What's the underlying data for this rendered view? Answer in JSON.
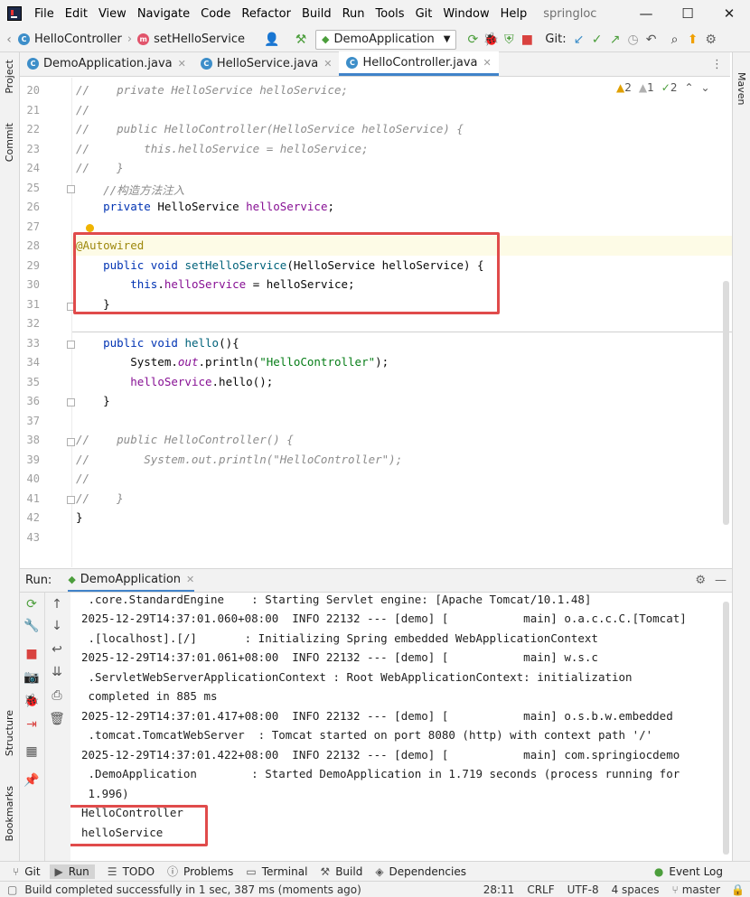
{
  "menubar": {
    "items": [
      "File",
      "Edit",
      "View",
      "Navigate",
      "Code",
      "Refactor",
      "Build",
      "Run",
      "Tools",
      "Git",
      "Window",
      "Help"
    ],
    "project": "springloc",
    "minimize": "—",
    "maximize": "☐",
    "close": "✕"
  },
  "navbar": {
    "breadcrumb_class": "HelloController",
    "breadcrumb_method": "setHelloService",
    "run_config": "DemoApplication",
    "git_label": "Git:"
  },
  "tabs": [
    {
      "label": "DemoApplication.java"
    },
    {
      "label": "HelloService.java"
    },
    {
      "label": "HelloController.java"
    }
  ],
  "side": {
    "project": "Project",
    "commit": "Commit",
    "structure": "Structure",
    "bookmarks": "Bookmarks",
    "maven": "Maven"
  },
  "inspections": {
    "warnings": "2",
    "weak": "1",
    "ok": "2"
  },
  "editor": {
    "line_numbers": [
      "20",
      "21",
      "22",
      "23",
      "24",
      "25",
      "26",
      "27",
      "28",
      "29",
      "30",
      "31",
      "32",
      "33",
      "34",
      "35",
      "36",
      "37",
      "38",
      "39",
      "40",
      "41",
      "42",
      "43"
    ]
  },
  "run_panel": {
    "label": "Run:",
    "tab": "DemoApplication",
    "console_lines": [
      " .core.StandardEngine    : Starting Servlet engine: [Apache Tomcat/10.1.48]",
      "2025-12-29T14:37:01.060+08:00  INFO 22132 --- [demo] [           main] o.a.c.c.C.[Tomcat]",
      " .[localhost].[/]       : Initializing Spring embedded WebApplicationContext",
      "2025-12-29T14:37:01.061+08:00  INFO 22132 --- [demo] [           main] w.s.c",
      " .ServletWebServerApplicationContext : Root WebApplicationContext: initialization",
      " completed in 885 ms",
      "2025-12-29T14:37:01.417+08:00  INFO 22132 --- [demo] [           main] o.s.b.w.embedded",
      " .tomcat.TomcatWebServer  : Tomcat started on port 8080 (http) with context path '/'",
      "2025-12-29T14:37:01.422+08:00  INFO 22132 --- [demo] [           main] com.springiocdemo",
      " .DemoApplication        : Started DemoApplication in 1.719 seconds (process running for",
      " 1.996)",
      "HelloController",
      "helloService"
    ]
  },
  "bottom_tools": [
    "Git",
    "Run",
    "TODO",
    "Problems",
    "Terminal",
    "Build",
    "Dependencies"
  ],
  "event_log": "Event Log",
  "status": {
    "message": "Build completed successfully in 1 sec, 387 ms (moments ago)",
    "position": "28:11",
    "line_sep": "CRLF",
    "encoding": "UTF-8",
    "indent": "4 spaces",
    "branch": "master"
  }
}
